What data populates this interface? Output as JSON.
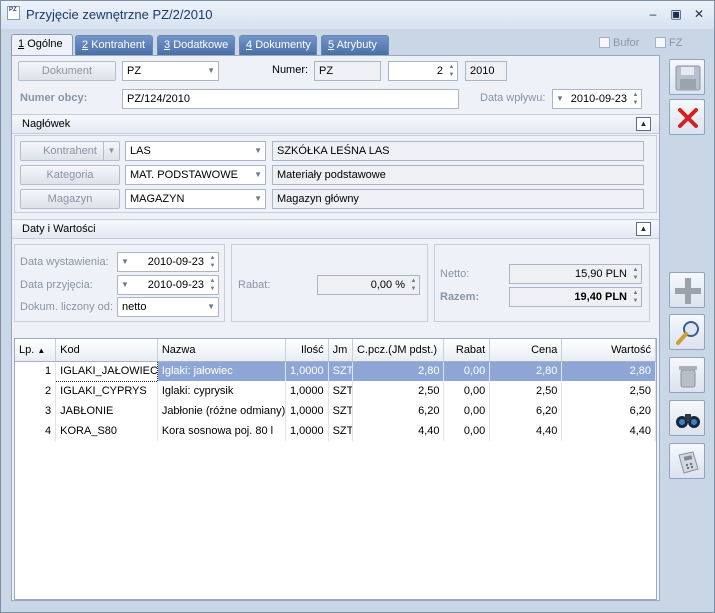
{
  "window": {
    "title": "Przyjęcie zewnętrzne PZ/2/2010",
    "icon_text": "PZ"
  },
  "tabs": [
    {
      "num": "1",
      "label": "Ogólne",
      "active": true
    },
    {
      "num": "2",
      "label": "Kontrahent"
    },
    {
      "num": "3",
      "label": "Dodatkowe"
    },
    {
      "num": "4",
      "label": "Dokumenty"
    },
    {
      "num": "5",
      "label": "Atrybuty"
    }
  ],
  "flags": {
    "bufor": "Bufor",
    "fz": "FZ"
  },
  "header": {
    "dokument_label": "Dokument",
    "dokument_value": "PZ",
    "numer_label": "Numer:",
    "numer_prefix": "PZ",
    "numer_value": "2",
    "numer_year": "2010",
    "numer_obcy_label": "Numer obcy:",
    "numer_obcy_value": "PZ/124/2010",
    "data_wplywu_label": "Data wpływu:",
    "data_wplywu_value": "2010-09-23"
  },
  "naglowek": {
    "title": "Nagłówek",
    "kontrahent_label": "Kontrahent",
    "kontrahent_code": "LAS",
    "kontrahent_name": "SZKÓŁKA LEŚNA LAS",
    "kategoria_label": "Kategoria",
    "kategoria_code": "MAT. PODSTAWOWE",
    "kategoria_name": "Materiały podstawowe",
    "magazyn_label": "Magazyn",
    "magazyn_code": "MAGAZYN",
    "magazyn_name": "Magazyn główny"
  },
  "daty": {
    "title": "Daty i Wartości",
    "data_wystawienia_label": "Data wystawienia:",
    "data_wystawienia_value": "2010-09-23",
    "data_przyjecia_label": "Data przyjęcia:",
    "data_przyjecia_value": "2010-09-23",
    "dokum_liczony_label": "Dokum. liczony od:",
    "dokum_liczony_value": "netto",
    "rabat_label": "Rabat:",
    "rabat_value": "0,00 %",
    "netto_label": "Netto:",
    "netto_value": "15,90 PLN",
    "razem_label": "Razem:",
    "razem_value": "19,40 PLN"
  },
  "table": {
    "columns": [
      "Lp.",
      "Kod",
      "Nazwa",
      "Ilość",
      "Jm",
      "C.pcz.(JM pdst.)",
      "Rabat",
      "Cena",
      "Wartość"
    ],
    "sort_indicator": "▲",
    "rows": [
      [
        "1",
        "IGLAKI_JAŁOWIEC",
        "Iglaki: jałowiec",
        "1,0000",
        "SZT",
        "2,80",
        "0,00",
        "2,80",
        "2,80"
      ],
      [
        "2",
        "IGLAKI_CYPRYS",
        "Iglaki: cyprysik",
        "1,0000",
        "SZT",
        "2,50",
        "0,00",
        "2,50",
        "2,50"
      ],
      [
        "3",
        "JABŁONIE",
        "Jabłonie (różne odmiany)",
        "1,0000",
        "SZT",
        "6,20",
        "0,00",
        "6,20",
        "6,20"
      ],
      [
        "4",
        "KORA_S80",
        "Kora sosnowa poj. 80 l",
        "1,0000",
        "SZT",
        "4,40",
        "0,00",
        "4,40",
        "4,40"
      ]
    ]
  },
  "colors": {
    "tab_blue": "#4a6fa8",
    "selection": "#8ea6d6",
    "cancel_red": "#d42020"
  }
}
